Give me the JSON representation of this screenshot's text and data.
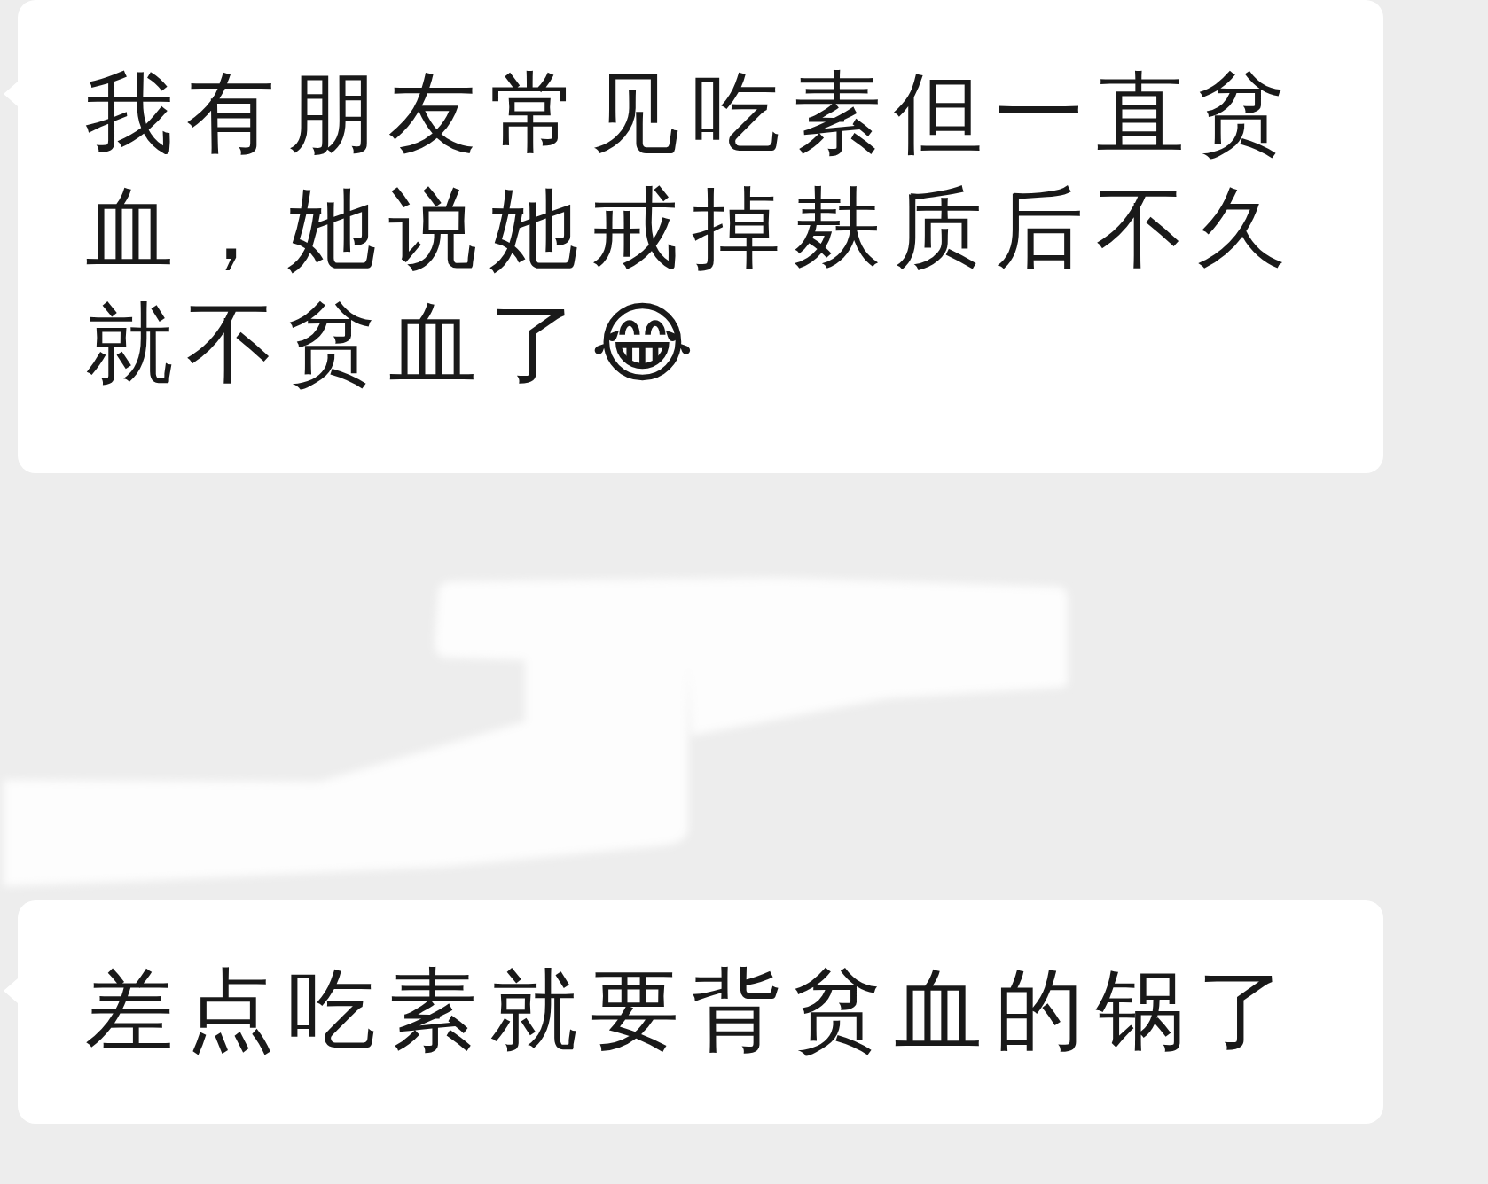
{
  "messages": [
    {
      "text": "我有朋友常见吃素但一直贫血，她说她戒掉麸质后不久就不贫血了😂"
    },
    {
      "text": "差点吃素就要背贫血的锅了"
    }
  ]
}
